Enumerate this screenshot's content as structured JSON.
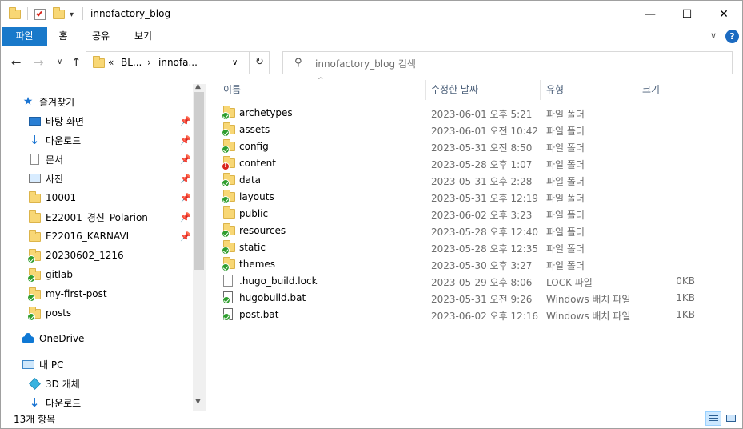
{
  "window": {
    "title": "innofactory_blog",
    "min_glyph": "—",
    "max_glyph": "☐",
    "close_glyph": "✕"
  },
  "ribbon": {
    "tabs": [
      {
        "label": "파일"
      },
      {
        "label": "홈"
      },
      {
        "label": "공유"
      },
      {
        "label": "보기"
      }
    ],
    "expand_glyph": "∨",
    "help_glyph": "?"
  },
  "address": {
    "overflow": "«",
    "segments": [
      "BL...",
      "innofa..."
    ],
    "separator": "›",
    "dropdown_glyph": "∨",
    "refresh_glyph": "↻"
  },
  "nav_buttons": {
    "back": "←",
    "forward": "→",
    "recent": "∨",
    "up": "↑"
  },
  "search": {
    "placeholder": "innofactory_blog 검색",
    "icon_glyph": "⚲"
  },
  "navpane": {
    "quick_access_label": "즐겨찾기",
    "pinned": [
      {
        "label": "바탕 화면",
        "icon": "desktop-icon"
      },
      {
        "label": "다운로드",
        "icon": "download-icon"
      },
      {
        "label": "문서",
        "icon": "documents-icon"
      },
      {
        "label": "사진",
        "icon": "pictures-icon"
      },
      {
        "label": "10001",
        "icon": "folder-icon"
      },
      {
        "label": "E22001_경신_Polarion",
        "icon": "folder-icon"
      },
      {
        "label": "E22016_KARNAVI",
        "icon": "folder-icon"
      }
    ],
    "unpinned": [
      {
        "label": "20230602_1216",
        "icon": "folder-synced-icon"
      },
      {
        "label": "gitlab",
        "icon": "folder-synced-icon"
      },
      {
        "label": "my-first-post",
        "icon": "folder-synced-icon"
      },
      {
        "label": "posts",
        "icon": "folder-synced-icon"
      }
    ],
    "onedrive_label": "OneDrive",
    "this_pc_label": "내 PC",
    "pc_children": [
      {
        "label": "3D 개체",
        "icon": "3d-objects-icon"
      },
      {
        "label": "다운로드",
        "icon": "download-icon"
      }
    ],
    "pin_glyph": "📌",
    "scroll_up_glyph": "▲",
    "scroll_down_glyph": "▼"
  },
  "columns": {
    "name": "이름",
    "date": "수정한 날짜",
    "type": "유형",
    "size": "크기",
    "sort_glyph": "^"
  },
  "files": [
    {
      "name": "archetypes",
      "date": "2023-06-01 오후 5:21",
      "type": "파일 폴더",
      "size": "",
      "icon": "folder-synced-icon"
    },
    {
      "name": "assets",
      "date": "2023-06-01 오전 10:42",
      "type": "파일 폴더",
      "size": "",
      "icon": "folder-synced-icon"
    },
    {
      "name": "config",
      "date": "2023-05-31 오전 8:50",
      "type": "파일 폴더",
      "size": "",
      "icon": "folder-synced-icon"
    },
    {
      "name": "content",
      "date": "2023-05-28 오후 1:07",
      "type": "파일 폴더",
      "size": "",
      "icon": "folder-conflict-icon"
    },
    {
      "name": "data",
      "date": "2023-05-31 오후 2:28",
      "type": "파일 폴더",
      "size": "",
      "icon": "folder-synced-icon"
    },
    {
      "name": "layouts",
      "date": "2023-05-31 오후 12:19",
      "type": "파일 폴더",
      "size": "",
      "icon": "folder-synced-icon"
    },
    {
      "name": "public",
      "date": "2023-06-02 오후 3:23",
      "type": "파일 폴더",
      "size": "",
      "icon": "folder-icon"
    },
    {
      "name": "resources",
      "date": "2023-05-28 오후 12:40",
      "type": "파일 폴더",
      "size": "",
      "icon": "folder-synced-icon"
    },
    {
      "name": "static",
      "date": "2023-05-28 오후 12:35",
      "type": "파일 폴더",
      "size": "",
      "icon": "folder-synced-icon"
    },
    {
      "name": "themes",
      "date": "2023-05-30 오후 3:27",
      "type": "파일 폴더",
      "size": "",
      "icon": "folder-synced-icon"
    },
    {
      "name": ".hugo_build.lock",
      "date": "2023-05-29 오후 8:06",
      "type": "LOCK 파일",
      "size": "0KB",
      "icon": "file-icon"
    },
    {
      "name": "hugobuild.bat",
      "date": "2023-05-31 오전 9:26",
      "type": "Windows 배치 파일",
      "size": "1KB",
      "icon": "batch-file-icon"
    },
    {
      "name": "post.bat",
      "date": "2023-06-02 오후 12:16",
      "type": "Windows 배치 파일",
      "size": "1KB",
      "icon": "batch-file-icon"
    }
  ],
  "status": {
    "item_count": "13개 항목"
  }
}
